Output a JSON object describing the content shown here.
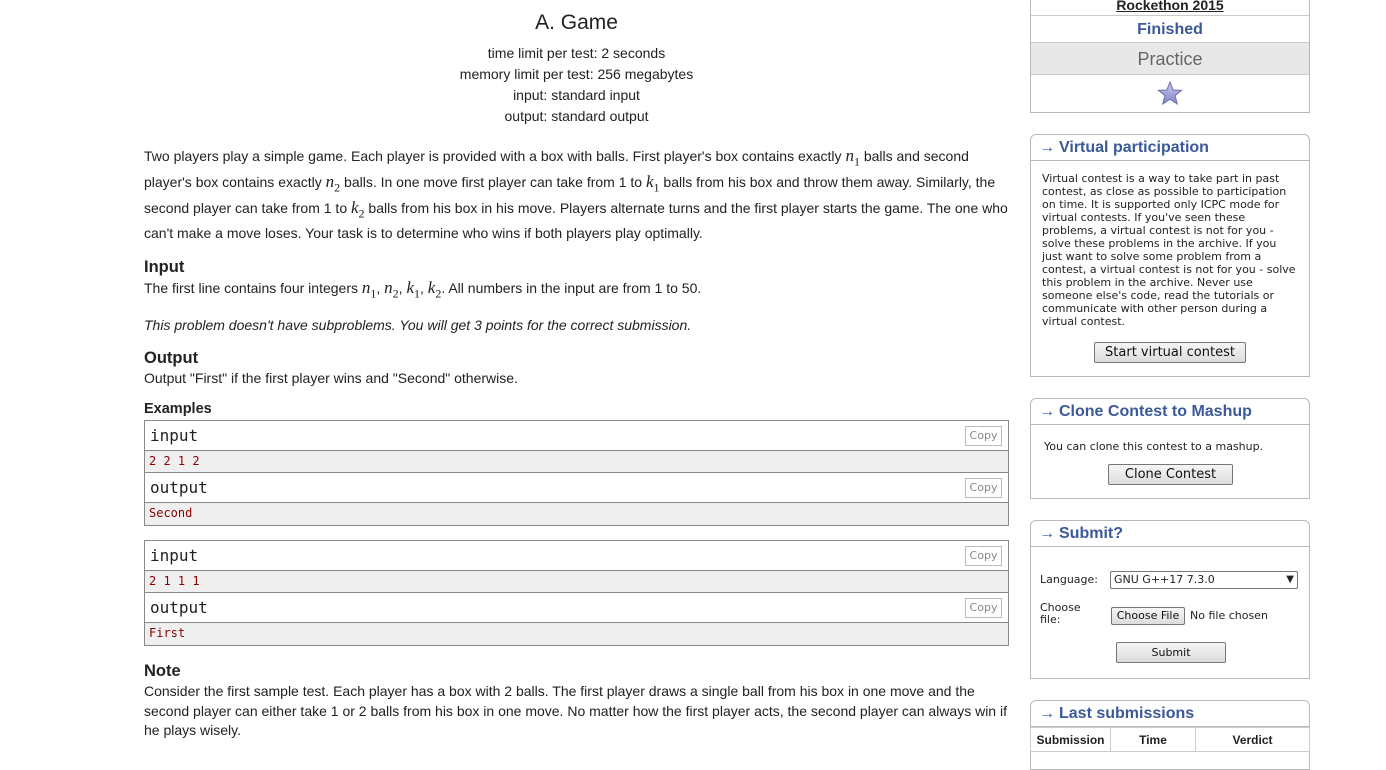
{
  "problem": {
    "title": "A. Game",
    "limits": [
      "time limit per test: 2 seconds",
      "memory limit per test: 256 megabytes",
      "input: standard input",
      "output: standard output"
    ],
    "legend": {
      "p1": "Two players play a simple game. Each player is provided with a box with balls. First player's box contains exactly ",
      "n1_var": "n",
      "n1_sub": "1",
      "p2": " balls and second player's box contains exactly ",
      "n2_var": "n",
      "n2_sub": "2",
      "p3": " balls. In one move first player can take from 1 to ",
      "k1_var": "k",
      "k1_sub": "1",
      "p4": " balls from his box and throw them away. Similarly, the second player can take from 1 to ",
      "k2_var": "k",
      "k2_sub": "2",
      "p5": " balls from his box in his move. Players alternate turns and the first player starts the game. The one who can't make a move loses. Your task is to determine who wins if both players play optimally."
    },
    "input_title": "Input",
    "input_text": {
      "pre": "The first line contains four integers ",
      "sep": ", ",
      "post": ". All numbers in the input are from 1 to 50."
    },
    "subproblems_note": "This problem doesn't have subproblems. You will get 3 points for the correct submission.",
    "output_title": "Output",
    "output_text": "Output \"First\" if the first player wins and \"Second\" otherwise.",
    "examples_title": "Examples",
    "examples": [
      {
        "input_label": "input",
        "input": "2 2 1 2",
        "output_label": "output",
        "output": "Second",
        "copy": "Copy"
      },
      {
        "input_label": "input",
        "input": "2 1 1 1",
        "output_label": "output",
        "output": "First",
        "copy": "Copy"
      }
    ],
    "note_title": "Note",
    "note_text": "Consider the first sample test. Each player has a box with 2 balls. The first player draws a single ball from his box in one move and the second player can either take 1 or 2 balls from his box in one move. No matter how the first player acts, the second player can always win if he plays wisely."
  },
  "sidebar": {
    "contest_name": "Rockethon 2015",
    "status": "Finished",
    "mode": "Practice",
    "star_icon": "star-icon",
    "virtual": {
      "arrow": "→",
      "caption": "Virtual participation",
      "text": "Virtual contest is a way to take part in past contest, as close as possible to participation on time. It is supported only ICPC mode for virtual contests. If you've seen these problems, a virtual contest is not for you - solve these problems in the archive. If you just want to solve some problem from a contest, a virtual contest is not for you - solve this problem in the archive. Never use someone else's code, read the tutorials or communicate with other person during a virtual contest.",
      "button": "Start virtual contest"
    },
    "clone": {
      "arrow": "→",
      "caption": "Clone Contest to Mashup",
      "text": "You can clone this contest to a mashup.",
      "button": "Clone Contest"
    },
    "submit": {
      "arrow": "→",
      "caption": "Submit?",
      "language_label": "Language:",
      "language_value": "GNU G++17 7.3.0",
      "file_label": "Choose file:",
      "choose_button": "Choose File",
      "no_file": "No file chosen",
      "submit_button": "Submit"
    },
    "last": {
      "arrow": "→",
      "caption": "Last submissions",
      "columns": [
        "Submission",
        "Time",
        "Verdict"
      ]
    }
  }
}
